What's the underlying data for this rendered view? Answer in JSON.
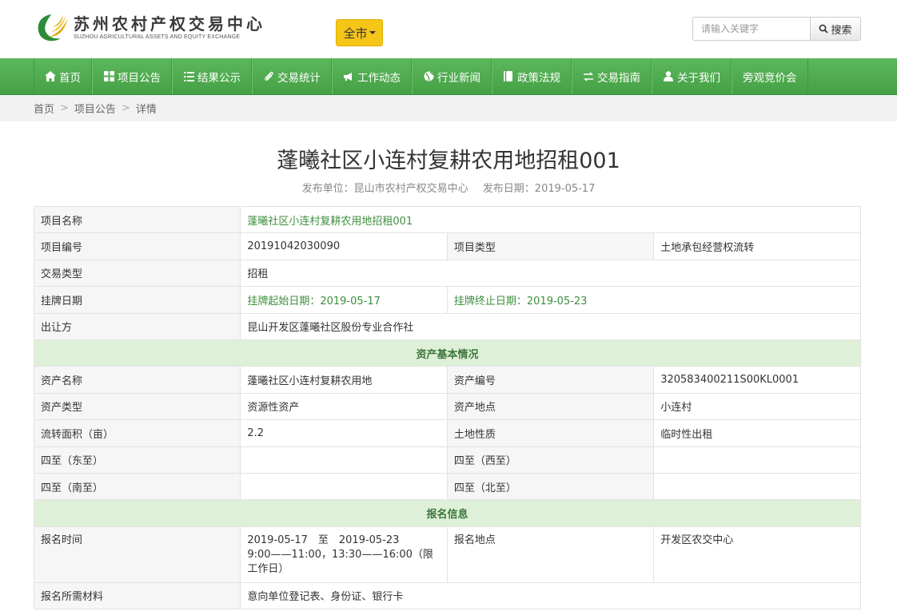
{
  "header": {
    "logo_cn": "苏州农村产权交易中心",
    "logo_en": "SUZHOU AGRICULTURAL ASSETS AND EQUITY EXCHANGE",
    "city_label": "全市",
    "search_placeholder": "请输入关键字",
    "search_label": "搜索"
  },
  "nav": [
    {
      "label": "首页",
      "icon": "home-icon"
    },
    {
      "label": "项目公告",
      "icon": "grid-icon"
    },
    {
      "label": "结果公示",
      "icon": "list-icon"
    },
    {
      "label": "交易统计",
      "icon": "paperclip-icon"
    },
    {
      "label": "工作动态",
      "icon": "bullhorn-icon"
    },
    {
      "label": "行业新闻",
      "icon": "globe-icon"
    },
    {
      "label": "政策法规",
      "icon": "book-icon"
    },
    {
      "label": "交易指南",
      "icon": "transfer-icon"
    },
    {
      "label": "关于我们",
      "icon": "user-icon"
    },
    {
      "label": "旁观竞价会",
      "icon": ""
    }
  ],
  "breadcrumb": [
    "首页",
    "项目公告",
    "详情"
  ],
  "page": {
    "title": "蓬曦社区小连村复耕农用地招租001",
    "publisher": "发布单位：昆山市农村产权交易中心",
    "date": "发布日期：2019-05-17"
  },
  "table": {
    "project_name_label": "项目名称",
    "project_name": "蓬曦社区小连村复耕农用地招租001",
    "project_no_label": "项目编号",
    "project_no": "20191042030090",
    "project_type_label": "项目类型",
    "project_type": "土地承包经营权流转",
    "trade_type_label": "交易类型",
    "trade_type": "招租",
    "listing_label": "挂牌日期",
    "listing_start": "挂牌起始日期：2019-05-17",
    "listing_end": "挂牌终止日期：2019-05-23",
    "seller_label": "出让方",
    "seller": "昆山开发区蓬曦社区股份专业合作社",
    "section_asset": "资产基本情况",
    "asset_name_label": "资产名称",
    "asset_name": "蓬曦社区小连村复耕农用地",
    "asset_no_label": "资产编号",
    "asset_no": "320583400211S00KL0001",
    "asset_type_label": "资产类型",
    "asset_type": "资源性资产",
    "asset_loc_label": "资产地点",
    "asset_loc": "小连村",
    "area_label": "流转面积（亩）",
    "area": "2.2",
    "land_nature_label": "土地性质",
    "land_nature": "临时性出租",
    "east_label": "四至（东至）",
    "west_label": "四至（西至）",
    "south_label": "四至（南至）",
    "north_label": "四至（北至）",
    "section_signup": "报名信息",
    "signup_time_label": "报名时间",
    "signup_time_line1": "2019-05-17　至　2019-05-23",
    "signup_time_line2": "9:00——11:00，13:30——16:00（限工作日）",
    "signup_place_label": "报名地点",
    "signup_place": "开发区农交中心",
    "materials_label": "报名所需材料",
    "materials": "意向单位登记表、身份证、银行卡"
  }
}
